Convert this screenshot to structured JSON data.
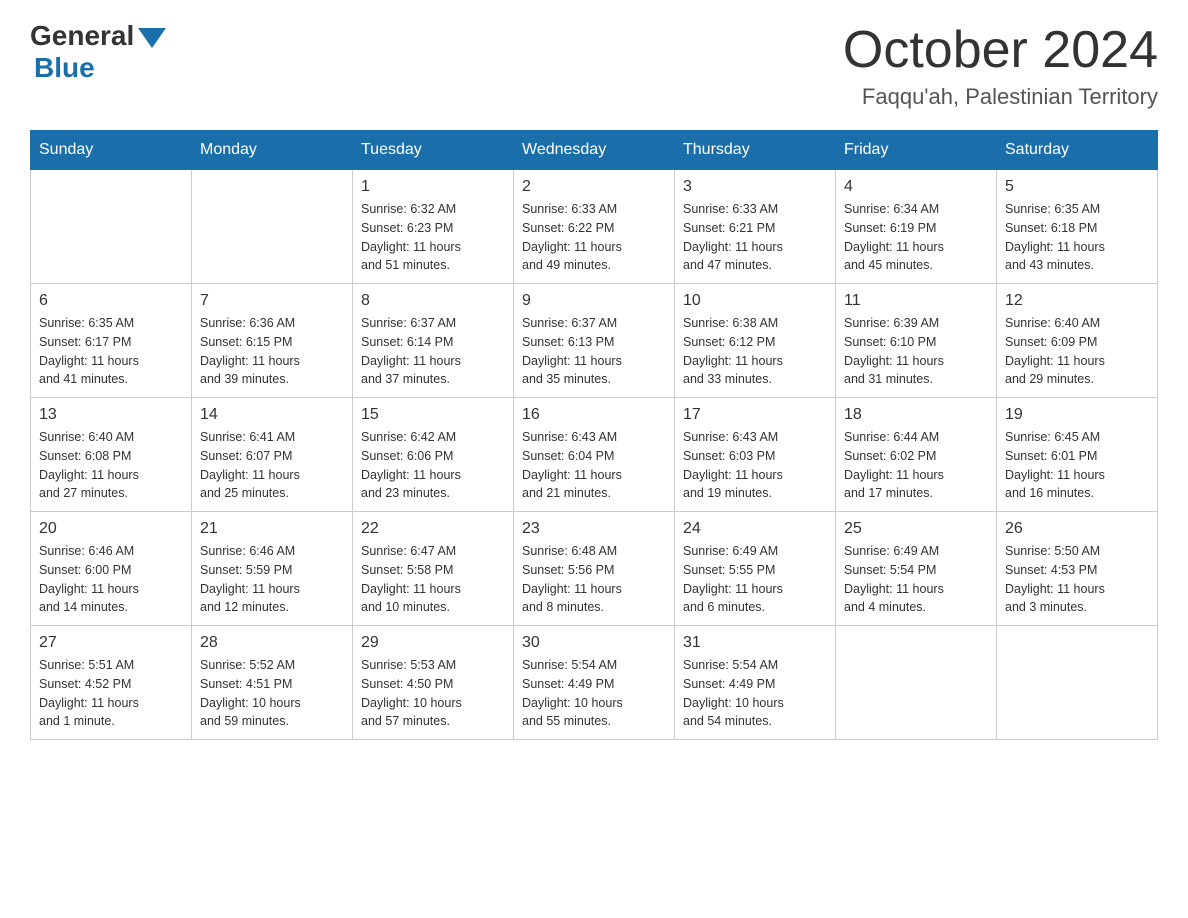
{
  "header": {
    "logo_general": "General",
    "logo_blue": "Blue",
    "month_title": "October 2024",
    "location": "Faqqu'ah, Palestinian Territory"
  },
  "days_of_week": [
    "Sunday",
    "Monday",
    "Tuesday",
    "Wednesday",
    "Thursday",
    "Friday",
    "Saturday"
  ],
  "weeks": [
    [
      {
        "day": "",
        "info": ""
      },
      {
        "day": "",
        "info": ""
      },
      {
        "day": "1",
        "info": "Sunrise: 6:32 AM\nSunset: 6:23 PM\nDaylight: 11 hours\nand 51 minutes."
      },
      {
        "day": "2",
        "info": "Sunrise: 6:33 AM\nSunset: 6:22 PM\nDaylight: 11 hours\nand 49 minutes."
      },
      {
        "day": "3",
        "info": "Sunrise: 6:33 AM\nSunset: 6:21 PM\nDaylight: 11 hours\nand 47 minutes."
      },
      {
        "day": "4",
        "info": "Sunrise: 6:34 AM\nSunset: 6:19 PM\nDaylight: 11 hours\nand 45 minutes."
      },
      {
        "day": "5",
        "info": "Sunrise: 6:35 AM\nSunset: 6:18 PM\nDaylight: 11 hours\nand 43 minutes."
      }
    ],
    [
      {
        "day": "6",
        "info": "Sunrise: 6:35 AM\nSunset: 6:17 PM\nDaylight: 11 hours\nand 41 minutes."
      },
      {
        "day": "7",
        "info": "Sunrise: 6:36 AM\nSunset: 6:15 PM\nDaylight: 11 hours\nand 39 minutes."
      },
      {
        "day": "8",
        "info": "Sunrise: 6:37 AM\nSunset: 6:14 PM\nDaylight: 11 hours\nand 37 minutes."
      },
      {
        "day": "9",
        "info": "Sunrise: 6:37 AM\nSunset: 6:13 PM\nDaylight: 11 hours\nand 35 minutes."
      },
      {
        "day": "10",
        "info": "Sunrise: 6:38 AM\nSunset: 6:12 PM\nDaylight: 11 hours\nand 33 minutes."
      },
      {
        "day": "11",
        "info": "Sunrise: 6:39 AM\nSunset: 6:10 PM\nDaylight: 11 hours\nand 31 minutes."
      },
      {
        "day": "12",
        "info": "Sunrise: 6:40 AM\nSunset: 6:09 PM\nDaylight: 11 hours\nand 29 minutes."
      }
    ],
    [
      {
        "day": "13",
        "info": "Sunrise: 6:40 AM\nSunset: 6:08 PM\nDaylight: 11 hours\nand 27 minutes."
      },
      {
        "day": "14",
        "info": "Sunrise: 6:41 AM\nSunset: 6:07 PM\nDaylight: 11 hours\nand 25 minutes."
      },
      {
        "day": "15",
        "info": "Sunrise: 6:42 AM\nSunset: 6:06 PM\nDaylight: 11 hours\nand 23 minutes."
      },
      {
        "day": "16",
        "info": "Sunrise: 6:43 AM\nSunset: 6:04 PM\nDaylight: 11 hours\nand 21 minutes."
      },
      {
        "day": "17",
        "info": "Sunrise: 6:43 AM\nSunset: 6:03 PM\nDaylight: 11 hours\nand 19 minutes."
      },
      {
        "day": "18",
        "info": "Sunrise: 6:44 AM\nSunset: 6:02 PM\nDaylight: 11 hours\nand 17 minutes."
      },
      {
        "day": "19",
        "info": "Sunrise: 6:45 AM\nSunset: 6:01 PM\nDaylight: 11 hours\nand 16 minutes."
      }
    ],
    [
      {
        "day": "20",
        "info": "Sunrise: 6:46 AM\nSunset: 6:00 PM\nDaylight: 11 hours\nand 14 minutes."
      },
      {
        "day": "21",
        "info": "Sunrise: 6:46 AM\nSunset: 5:59 PM\nDaylight: 11 hours\nand 12 minutes."
      },
      {
        "day": "22",
        "info": "Sunrise: 6:47 AM\nSunset: 5:58 PM\nDaylight: 11 hours\nand 10 minutes."
      },
      {
        "day": "23",
        "info": "Sunrise: 6:48 AM\nSunset: 5:56 PM\nDaylight: 11 hours\nand 8 minutes."
      },
      {
        "day": "24",
        "info": "Sunrise: 6:49 AM\nSunset: 5:55 PM\nDaylight: 11 hours\nand 6 minutes."
      },
      {
        "day": "25",
        "info": "Sunrise: 6:49 AM\nSunset: 5:54 PM\nDaylight: 11 hours\nand 4 minutes."
      },
      {
        "day": "26",
        "info": "Sunrise: 5:50 AM\nSunset: 4:53 PM\nDaylight: 11 hours\nand 3 minutes."
      }
    ],
    [
      {
        "day": "27",
        "info": "Sunrise: 5:51 AM\nSunset: 4:52 PM\nDaylight: 11 hours\nand 1 minute."
      },
      {
        "day": "28",
        "info": "Sunrise: 5:52 AM\nSunset: 4:51 PM\nDaylight: 10 hours\nand 59 minutes."
      },
      {
        "day": "29",
        "info": "Sunrise: 5:53 AM\nSunset: 4:50 PM\nDaylight: 10 hours\nand 57 minutes."
      },
      {
        "day": "30",
        "info": "Sunrise: 5:54 AM\nSunset: 4:49 PM\nDaylight: 10 hours\nand 55 minutes."
      },
      {
        "day": "31",
        "info": "Sunrise: 5:54 AM\nSunset: 4:49 PM\nDaylight: 10 hours\nand 54 minutes."
      },
      {
        "day": "",
        "info": ""
      },
      {
        "day": "",
        "info": ""
      }
    ]
  ]
}
